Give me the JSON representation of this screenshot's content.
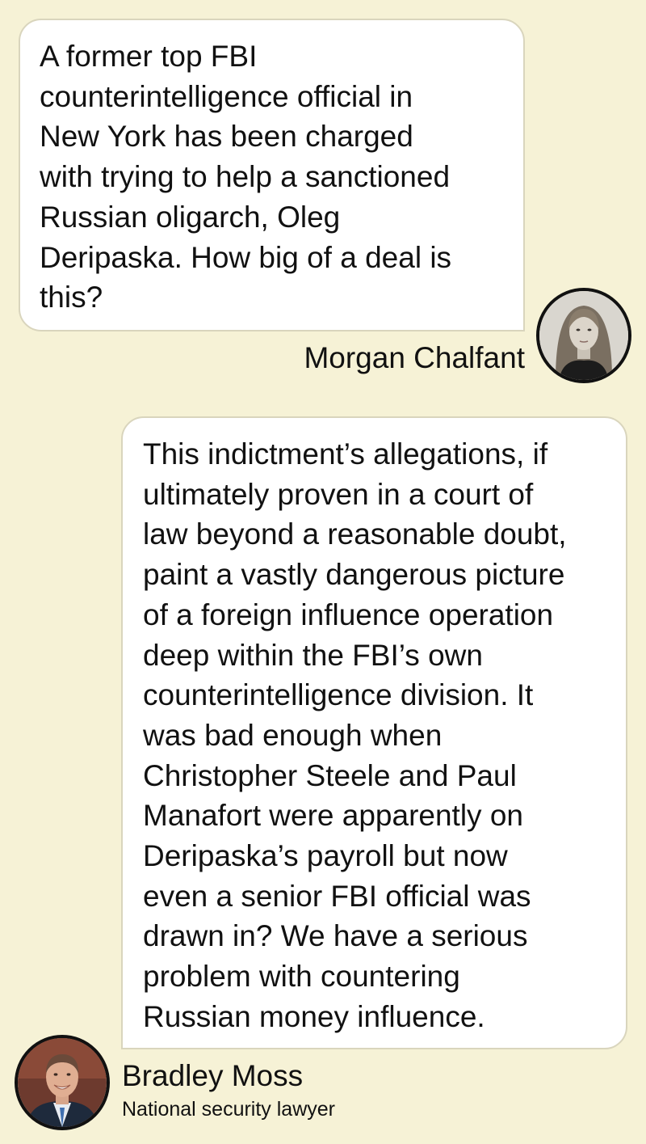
{
  "conversation": {
    "question": {
      "text": "A former top FBI\ncounterintelligence official in\nNew York has been charged\nwith trying to help a sanctioned\nRussian oligarch, Oleg\nDeripaska. How big of a deal is\nthis?",
      "speaker_name": "Morgan Chalfant"
    },
    "answer": {
      "text": "This indictment’s allegations, if\nultimately proven in a court of\nlaw beyond a reasonable doubt,\npaint a vastly dangerous picture\nof a foreign influence operation\ndeep within the FBI’s own\ncounterintelligence division. It\nwas bad enough when\nChristopher Steele and Paul\nManafort were apparently on\nDeripaska’s payroll but now\neven a senior FBI official was\ndrawn in? We have a serious\nproblem with countering\nRussian money influence.",
      "speaker_name": "Bradley Moss",
      "speaker_title": "National security lawyer"
    }
  },
  "colors": {
    "background": "#f6f2d6",
    "bubble": "#ffffff",
    "bubble_border": "#d9d5bd",
    "text": "#111111"
  }
}
